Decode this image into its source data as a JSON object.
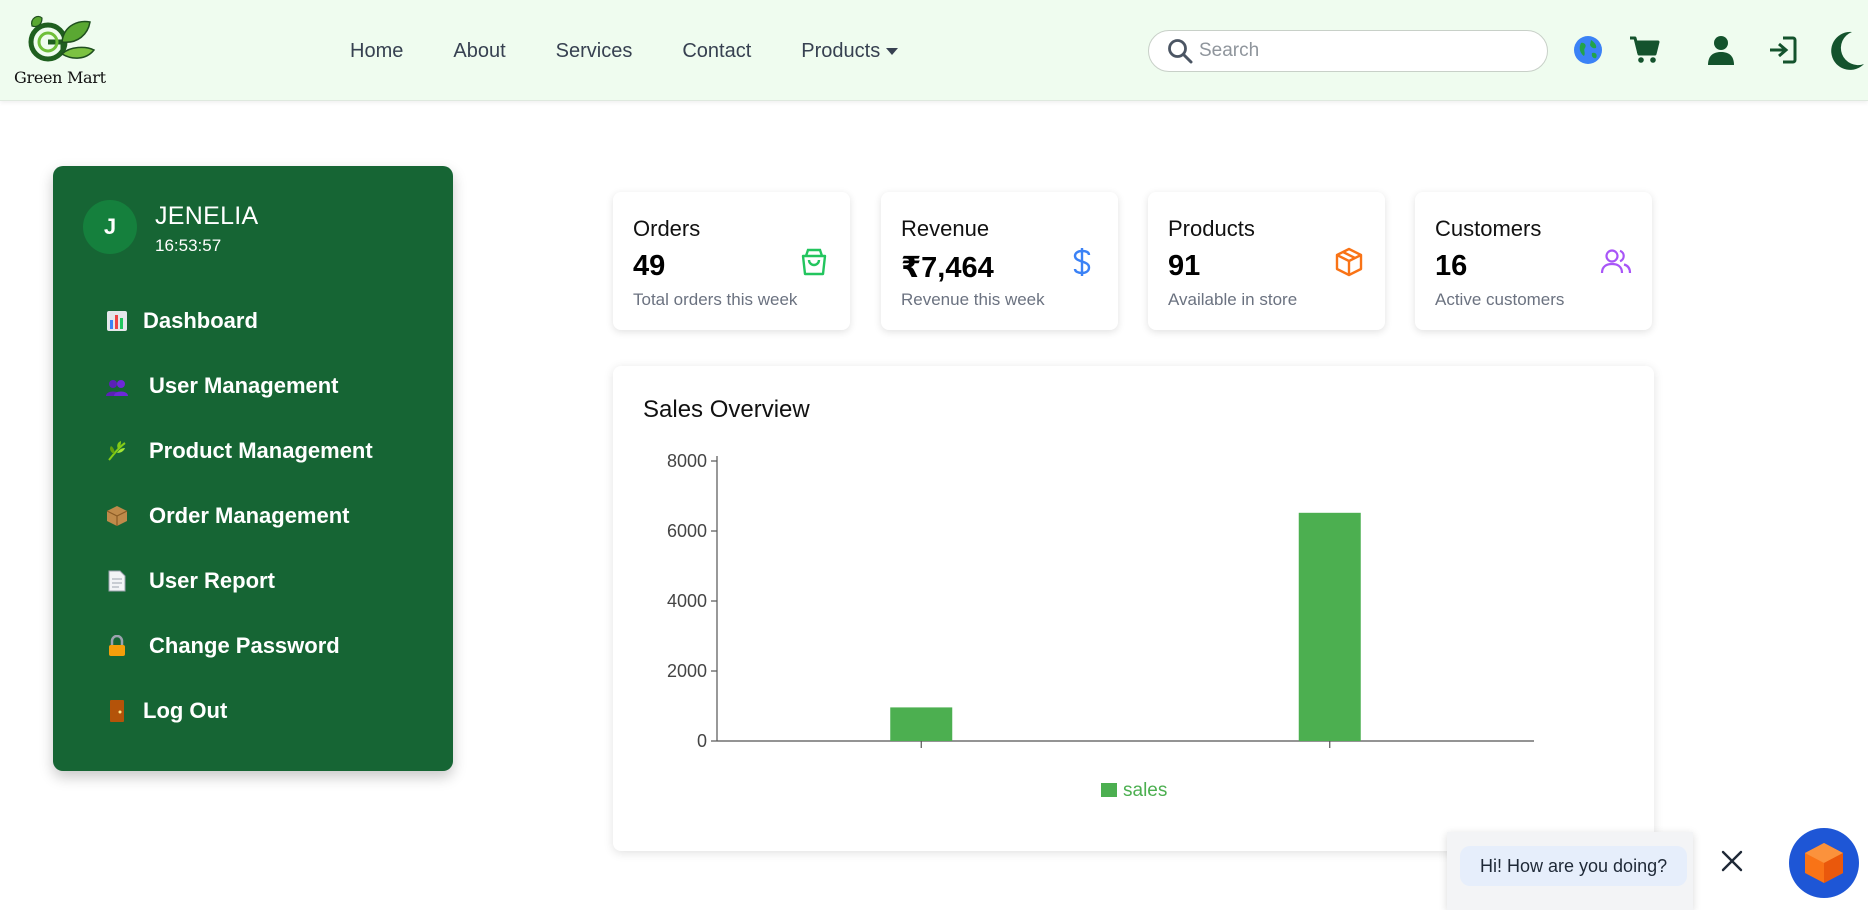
{
  "brand": {
    "name": "Green Mart"
  },
  "nav": {
    "items": [
      "Home",
      "About",
      "Services",
      "Contact"
    ],
    "products_label": "Products"
  },
  "search": {
    "placeholder": "Search",
    "value": ""
  },
  "header_icons": [
    "globe-icon",
    "cart-icon",
    "user-icon",
    "login-icon",
    "moon-icon"
  ],
  "sidebar": {
    "user": {
      "initial": "J",
      "name": "JENELIA",
      "time": "16:53:57"
    },
    "items": [
      {
        "label": "Dashboard",
        "icon": "bar-chart-icon"
      },
      {
        "label": "User Management",
        "icon": "users-icon"
      },
      {
        "label": "Product Management",
        "icon": "herb-icon"
      },
      {
        "label": "Order Management",
        "icon": "package-icon"
      },
      {
        "label": "User Report",
        "icon": "document-icon"
      },
      {
        "label": "Change Password",
        "icon": "lock-icon"
      },
      {
        "label": "Log Out",
        "icon": "door-icon"
      }
    ]
  },
  "stats": [
    {
      "title": "Orders",
      "value": "49",
      "sub": "Total orders this week",
      "icon": "shopping-bag-icon",
      "color": "#22c55e"
    },
    {
      "title": "Revenue",
      "value": "₹7,464",
      "sub": "Revenue this week",
      "icon": "dollar-icon",
      "color": "#3b82f6"
    },
    {
      "title": "Products",
      "value": "91",
      "sub": "Available in store",
      "icon": "box-icon",
      "color": "#f97316"
    },
    {
      "title": "Customers",
      "value": "16",
      "sub": "Active customers",
      "icon": "users-icon",
      "color": "#a855f7"
    }
  ],
  "chart": {
    "title": "Sales Overview"
  },
  "chart_data": {
    "type": "bar",
    "categories": [
      "",
      ""
    ],
    "series": [
      {
        "name": "sales",
        "values": [
          960,
          6520
        ],
        "color": "#4caf50"
      }
    ],
    "ylim": [
      0,
      8000
    ],
    "yticks": [
      0,
      2000,
      4000,
      6000,
      8000
    ],
    "legend": "bottom-center",
    "grid": false
  },
  "chat": {
    "message": "Hi! How are you doing?"
  },
  "colors": {
    "sidebar": "#166534",
    "header": "#effcef",
    "accent": "#15803d"
  }
}
